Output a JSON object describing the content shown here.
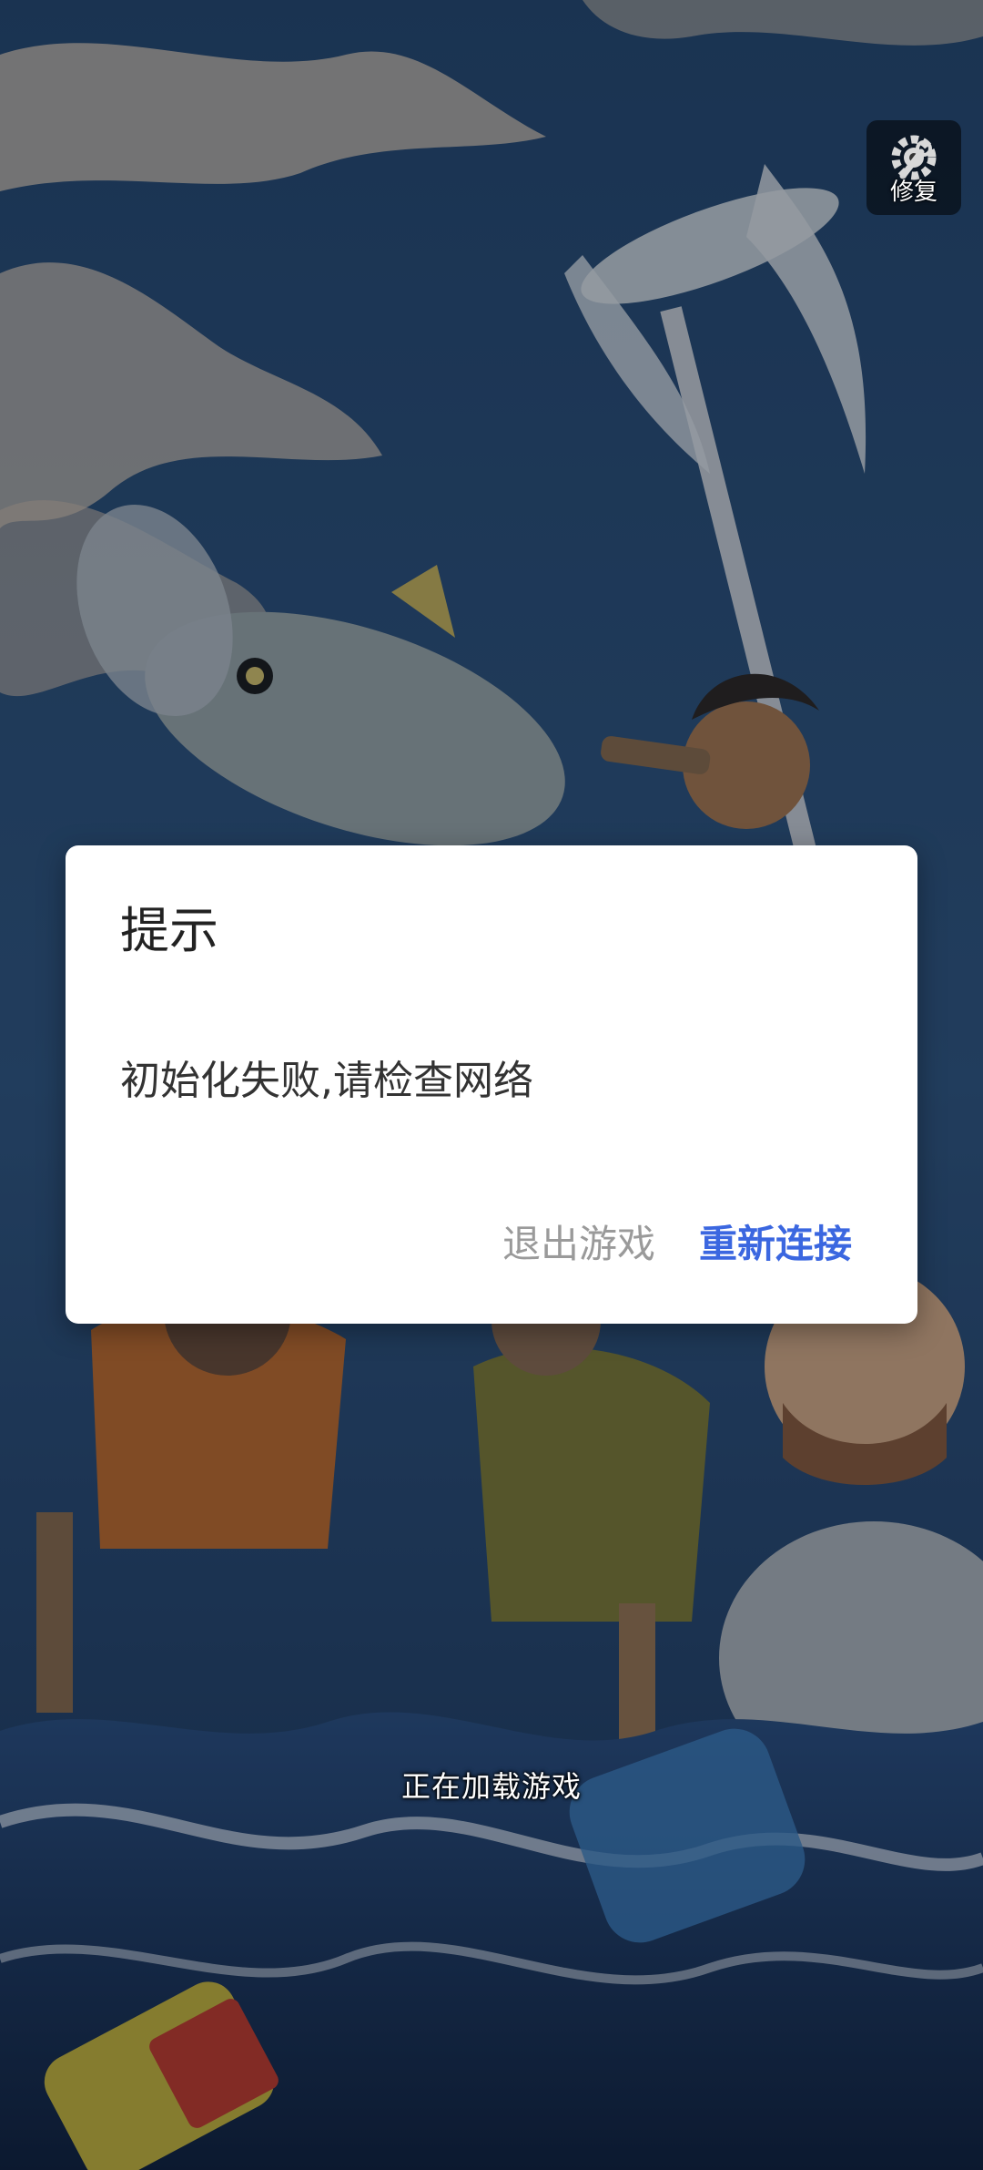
{
  "repair": {
    "label": "修复",
    "icon": "wrench-gear-icon"
  },
  "loading": {
    "text": "正在加载游戏"
  },
  "dialog": {
    "title": "提示",
    "message": "初始化失败,请检查网络",
    "exit_label": "退出游戏",
    "reconnect_label": "重新连接"
  },
  "colors": {
    "accent": "#3b67e0",
    "secondary_button": "#9a9a9a",
    "dialog_bg": "#ffffff",
    "sky": "#2a4a72",
    "sea": "#1e3a66"
  }
}
